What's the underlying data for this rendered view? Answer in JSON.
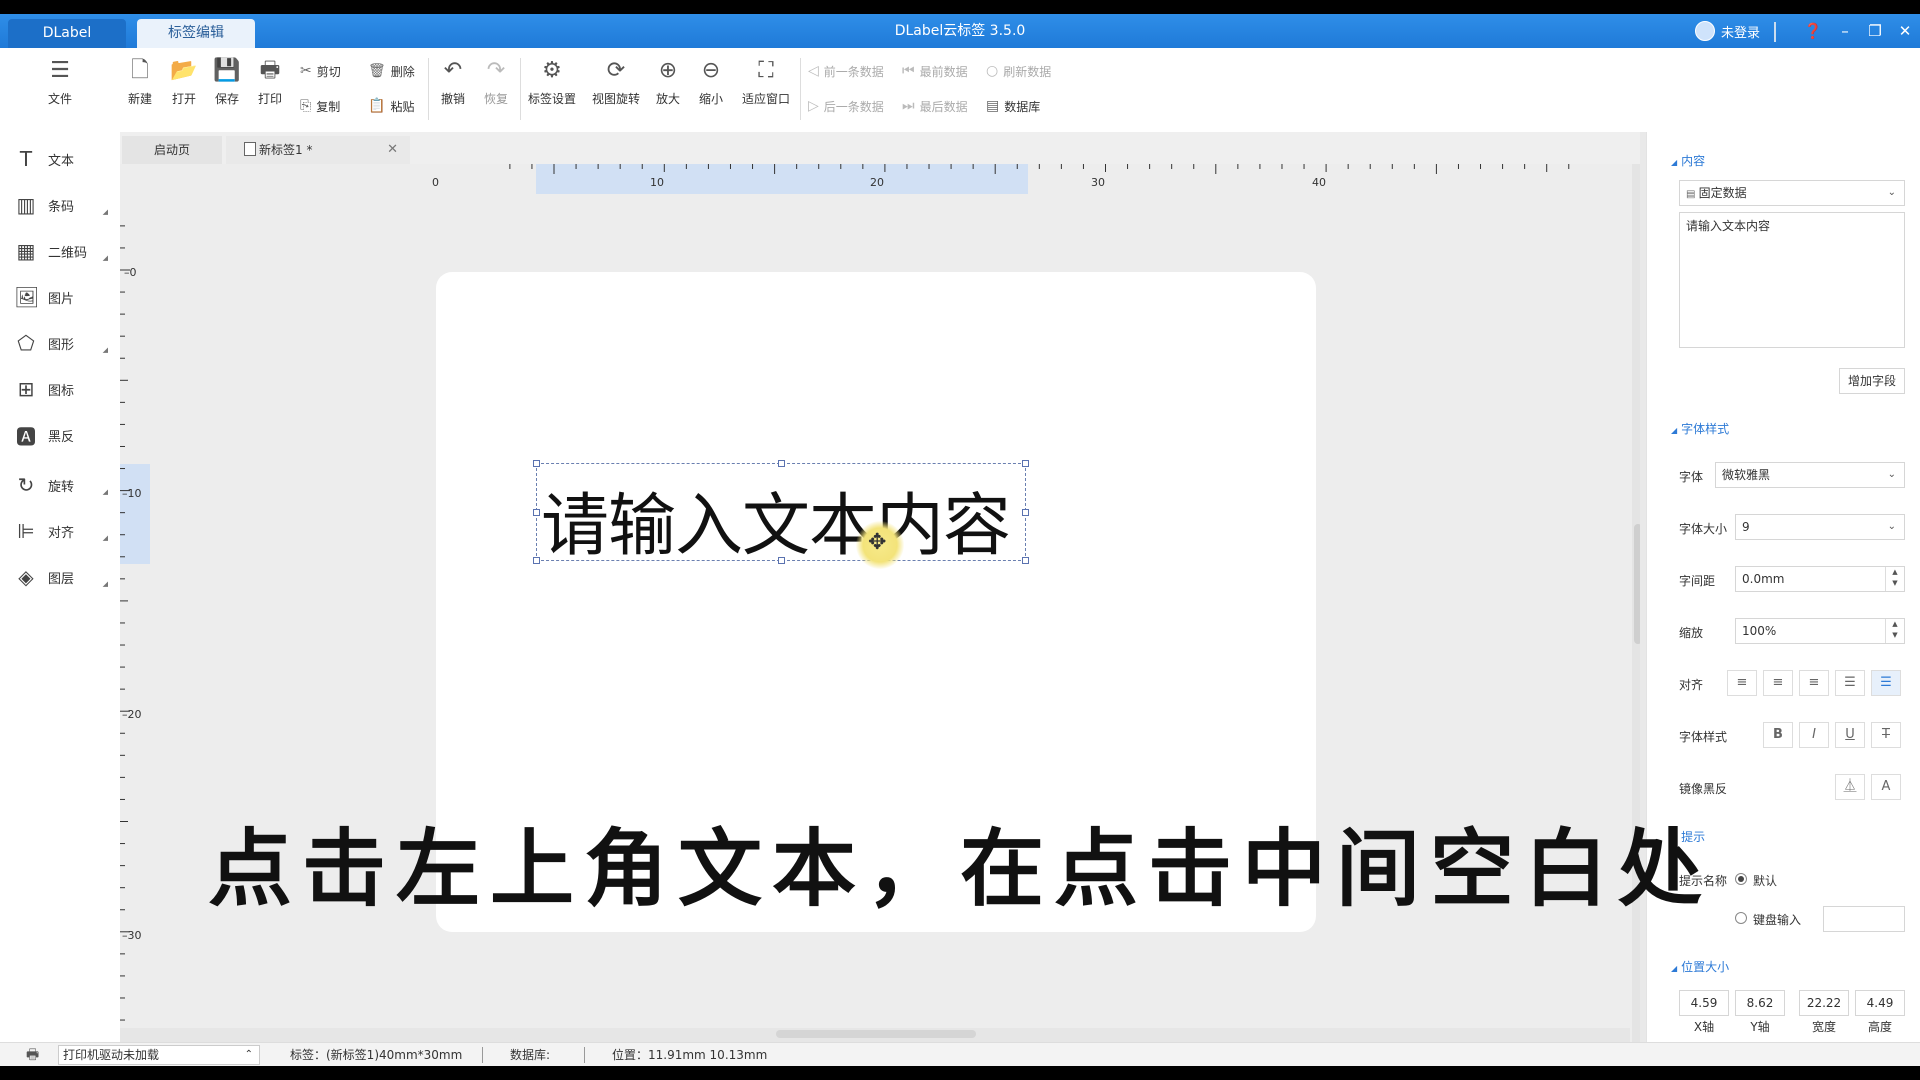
{
  "titlebar": {
    "tab_app": "DLabel",
    "tab_edit": "标签编辑",
    "title": "DLabel云标签 3.5.0",
    "login": "未登录"
  },
  "toolbar": {
    "file": "文件",
    "new": "新建",
    "open": "打开",
    "save": "保存",
    "print": "打印",
    "cut": "剪切",
    "copy": "复制",
    "delete": "删除",
    "paste": "粘贴",
    "undo": "撤销",
    "redo": "恢复",
    "label_settings": "标签设置",
    "view_rotate": "视图旋转",
    "zoom_in": "放大",
    "zoom_out": "缩小",
    "fit_window": "适应窗口",
    "prev_record": "前一条数据",
    "first_record": "最前数据",
    "refresh_data": "刷新数据",
    "next_record": "后一条数据",
    "last_record": "最后数据",
    "database": "数据库"
  },
  "sidebar": {
    "items": [
      {
        "label": "文本",
        "icon": "text-icon"
      },
      {
        "label": "条码",
        "icon": "barcode-icon"
      },
      {
        "label": "二维码",
        "icon": "qrcode-icon"
      },
      {
        "label": "图片",
        "icon": "image-icon"
      },
      {
        "label": "图形",
        "icon": "shape-icon"
      },
      {
        "label": "图标",
        "icon": "symbol-icon"
      },
      {
        "label": "黑反",
        "icon": "invert-icon"
      },
      {
        "label": "旋转",
        "icon": "rotate-icon"
      },
      {
        "label": "对齐",
        "icon": "align-icon"
      },
      {
        "label": "图层",
        "icon": "layers-icon"
      }
    ]
  },
  "doc_tabs": {
    "start": "启动页",
    "current": "新标签1 *"
  },
  "rulers": {
    "h_labels": [
      "0",
      "10",
      "20",
      "30",
      "40"
    ],
    "v_labels": [
      "0",
      "10",
      "20",
      "30"
    ]
  },
  "canvas": {
    "text_content": "请输入文本内容"
  },
  "subtitle": "点击左上角文本，在点击中间空白处",
  "panel": {
    "content_title": "内容",
    "data_source": "固定数据",
    "text_value": "请输入文本内容",
    "add_field": "增加字段",
    "font_style_title": "字体样式",
    "font_label": "字体",
    "font_value": "微软雅黑",
    "font_size_label": "字体大小",
    "font_size_value": "9",
    "spacing_label": "字间距",
    "spacing_value": "0.0mm",
    "scale_label": "缩放",
    "scale_value": "100%",
    "align_label": "对齐",
    "style_label": "字体样式",
    "mirror_label": "镜像黑反",
    "hint_title": "提示",
    "hint_name_label": "提示名称",
    "hint_default": "默认",
    "hint_keyboard": "键盘输入",
    "pos_title": "位置大小",
    "pos_x": "4.59",
    "pos_y": "8.62",
    "width": "22.22",
    "height": "4.49",
    "x_label": "X轴",
    "y_label": "Y轴",
    "w_label": "宽度",
    "h_label": "高度"
  },
  "statusbar": {
    "printer": "打印机驱动未加载",
    "label_info": "标签：(新标签1)40mm*30mm",
    "database": "数据库:",
    "position": "位置：11.91mm 10.13mm"
  }
}
